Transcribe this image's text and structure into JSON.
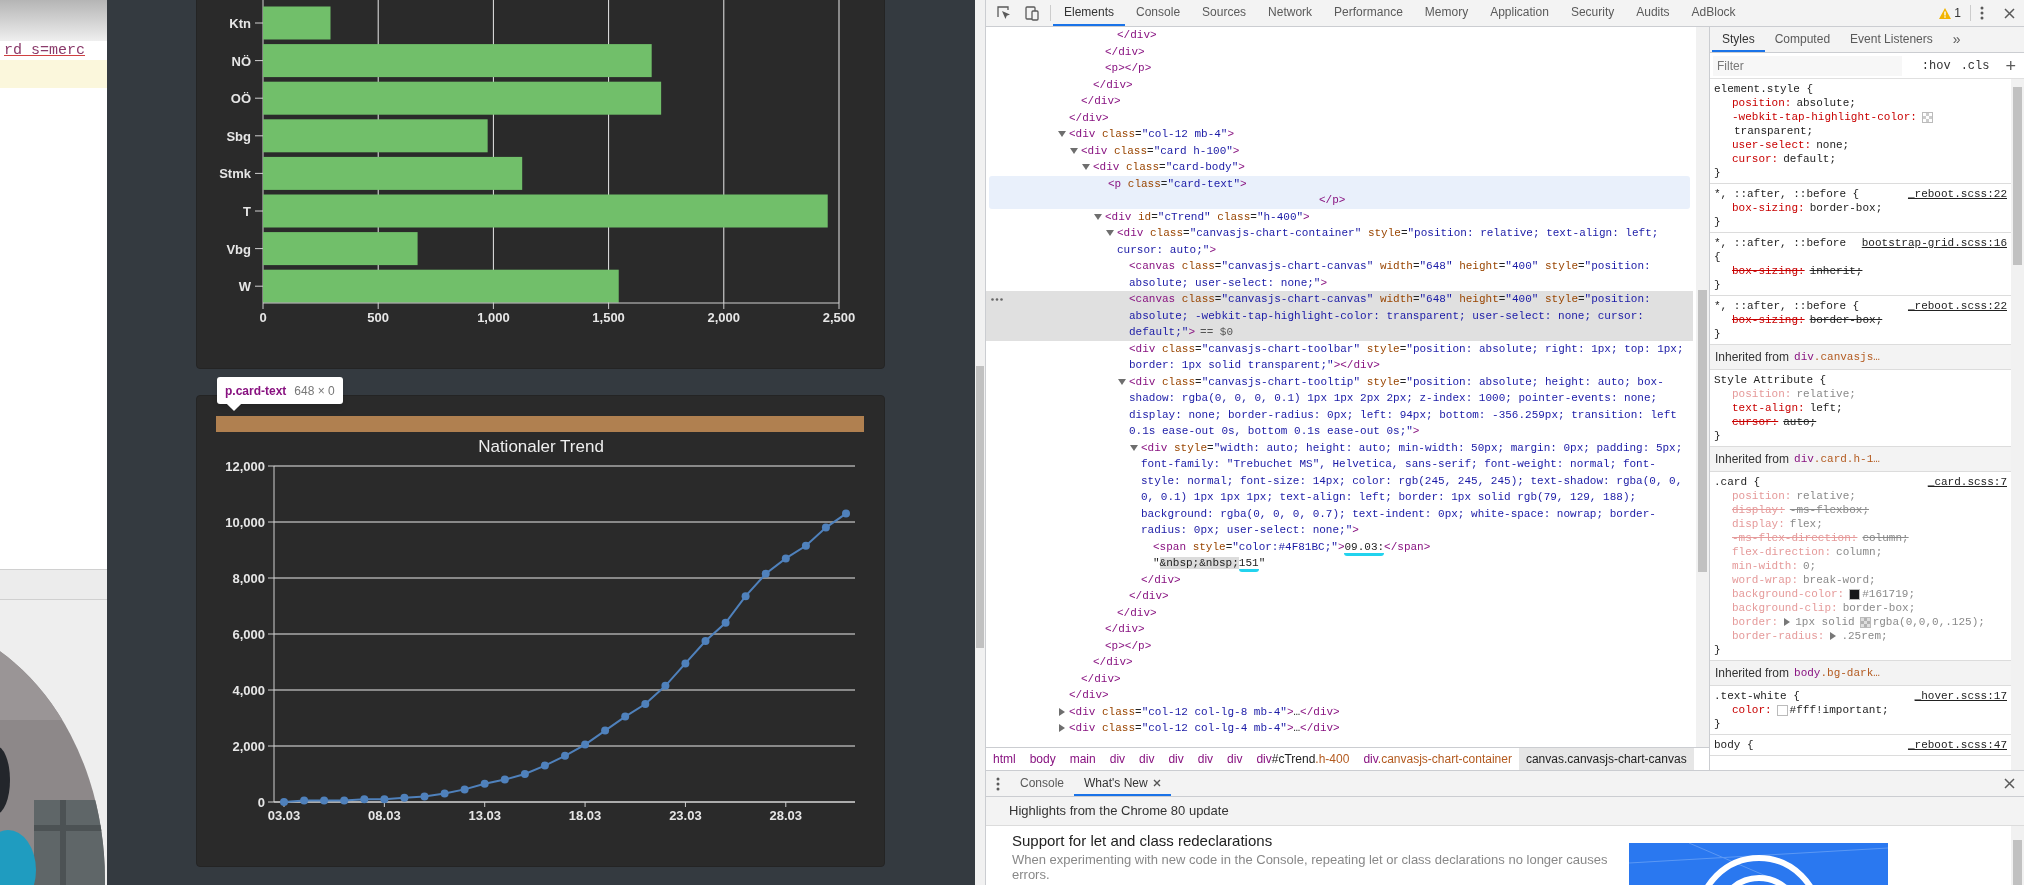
{
  "background_window": {
    "code_text": "rd s=merc"
  },
  "page": {
    "bar_chart_card": {
      "chart_data": {
        "type": "bar",
        "orientation": "horizontal",
        "categories": [
          "Ktn",
          "NÖ",
          "OÖ",
          "Sbg",
          "Stmk",
          "T",
          "Vbg",
          "W"
        ],
        "series": [
          {
            "color": "#71bf6a",
            "values": [
              293,
              1687,
              1728,
              975,
              1125,
              2451,
              671,
              1544
            ]
          }
        ],
        "grid": true,
        "xlim": [
          0,
          2500
        ],
        "xticks": [
          {
            "value": 0,
            "label": "0"
          },
          {
            "value": 500,
            "label": "500"
          },
          {
            "value": 1000,
            "label": "1,000"
          },
          {
            "value": 1500,
            "label": "1,500"
          },
          {
            "value": 2000,
            "label": "2,000"
          },
          {
            "value": 2500,
            "label": "2,500"
          }
        ]
      }
    },
    "inspect_tooltip": {
      "selector": "p.card-text",
      "size": "648 × 0"
    },
    "trend_card": {
      "chart_data": {
        "type": "line",
        "title": "Nationaler Trend",
        "categories": [
          "03.03",
          null,
          null,
          null,
          null,
          "08.03",
          null,
          null,
          null,
          null,
          "13.03",
          null,
          null,
          null,
          null,
          "18.03",
          null,
          null,
          null,
          null,
          "23.03",
          null,
          null,
          null,
          null,
          "28.03",
          null,
          null,
          null
        ],
        "series": [
          {
            "color": "#4f81bc",
            "marker": true,
            "values": [
              0,
              50,
              50,
              50,
              100,
              100,
              150,
              200,
              300,
              450,
              650,
              800,
              1000,
              1300,
              1650,
              2050,
              2550,
              3050,
              3500,
              4150,
              4950,
              5750,
              6400,
              7350,
              8150,
              8700,
              9150,
              9800,
              10300
            ]
          }
        ],
        "grid": true,
        "ylim": [
          0,
          12000
        ],
        "yticks": [
          {
            "value": 0,
            "label": "0"
          },
          {
            "value": 2000,
            "label": "2,000"
          },
          {
            "value": 4000,
            "label": "4,000"
          },
          {
            "value": 6000,
            "label": "6,000"
          },
          {
            "value": 8000,
            "label": "8,000"
          },
          {
            "value": 10000,
            "label": "10,000"
          },
          {
            "value": 12000,
            "label": "12,000"
          }
        ]
      }
    }
  },
  "devtools": {
    "toolbar": {
      "tabs": [
        {
          "label": "Elements",
          "selected": true
        },
        {
          "label": "Console",
          "selected": false
        },
        {
          "label": "Sources",
          "selected": false
        },
        {
          "label": "Network",
          "selected": false
        },
        {
          "label": "Performance",
          "selected": false
        },
        {
          "label": "Memory",
          "selected": false
        },
        {
          "label": "Application",
          "selected": false
        },
        {
          "label": "Security",
          "selected": false
        },
        {
          "label": "Audits",
          "selected": false
        },
        {
          "label": "AdBlock",
          "selected": false
        }
      ],
      "warning_count": "1"
    },
    "elements_tree": [
      {
        "close": "</div>",
        "children": [
          {
            "close": "</div>",
            "children": [
              {
                "close": "</div>",
                "children": [
                  {
                    "close": "</div>",
                    "children": [
                      {
                        "close": "</div>"
                      }
                    ]
                  },
                  {
                    "open": "<p></p>"
                  }
                ]
              }
            ]
          }
        ]
      },
      {
        "open": "<div class=\"col-12 mb-4\">",
        "expanded": true,
        "close": "</div>",
        "children": [
          {
            "open": "<div class=\"card h-100\">",
            "expanded": true,
            "close": "</div>",
            "children": [
              {
                "open": "<div class=\"card-body\">",
                "expanded": true,
                "close": "</div>",
                "children": [
                  {
                    "open": "<p class=\"card-text\">",
                    "close": "</p>",
                    "hovered": true
                  },
                  {
                    "open": "<div id=\"cTrend\" class=\"h-400\">",
                    "expanded": true,
                    "close": "</div>",
                    "children": [
                      {
                        "open": "<div class=\"canvasjs-chart-container\" style=\"position: relative; text-align: left; cursor: auto;\">",
                        "expanded": true,
                        "close": "</div>",
                        "children": [
                          {
                            "open": "<canvas class=\"canvasjs-chart-canvas\" width=\"648\" height=\"400\" style=\"position: absolute; user-select: none;\">"
                          },
                          {
                            "open": "<canvas class=\"canvasjs-chart-canvas\" width=\"648\" height=\"400\" style=\"position: absolute; -webkit-tap-highlight-color: transparent; user-select: none; cursor: default;\">",
                            "selected": true,
                            "console_ref": "== $0"
                          },
                          {
                            "open": "<div class=\"canvasjs-chart-toolbar\" style=\"position: absolute; right: 1px; top: 1px; border: 1px solid transparent;\"></div>"
                          },
                          {
                            "open": "<div class=\"canvasjs-chart-tooltip\" style=\"position: absolute; height: auto; box-shadow: rgba(0, 0, 0, 0.1) 1px 1px 2px 2px; z-index: 1000; pointer-events: none; display: none; border-radius: 0px; left: 94px; bottom: -356.259px; transition: left 0.1s ease-out 0s, bottom 0.1s ease-out 0s;\">",
                            "expanded": true,
                            "close": "</div>",
                            "children": [
                              {
                                "open": "<div style=\"width: auto; height: auto; min-width: 50px; margin: 0px; padding: 5px; font-family: \"Trebuchet MS\", Helvetica, sans-serif; font-weight: normal; font-style: normal; font-size: 14px; color: rgb(245, 245, 245); text-shadow: rgba(0, 0, 0, 0.1) 1px 1px 1px; text-align: left; border: 1px solid rgb(79, 129, 188); background: rgba(0, 0, 0, 0.7); text-indent: 0px; white-space: nowrap; border-radius: 0px; user-select: none;\">",
                                "expanded": true,
                                "close": "</div>",
                                "children": [
                                  {
                                    "parts": [
                                      {
                                        "kind": "tag",
                                        "text": "<span style=\"color:#4F81BC;\">"
                                      },
                                      {
                                        "kind": "text",
                                        "text": "09.03:",
                                        "marked": true
                                      },
                                      {
                                        "kind": "tag",
                                        "text": "</span>"
                                      }
                                    ]
                                  },
                                  {
                                    "parts": [
                                      {
                                        "kind": "text",
                                        "text": "\""
                                      },
                                      {
                                        "kind": "text",
                                        "text": "&nbsp;&nbsp;",
                                        "highlighted": true
                                      },
                                      {
                                        "kind": "text",
                                        "text": "151",
                                        "marked": true
                                      },
                                      {
                                        "kind": "text",
                                        "text": "\""
                                      }
                                    ]
                                  }
                                ]
                              }
                            ]
                          }
                        ]
                      }
                    ]
                  },
                  {
                    "open": "<p></p>"
                  }
                ]
              }
            ]
          }
        ]
      },
      {
        "open": "<div class=\"col-12 col-lg-8 mb-4\">…</div>",
        "expanded": false
      },
      {
        "open": "<div class=\"col-12 col-lg-4 mb-4\">…</div>",
        "expanded": false
      }
    ],
    "breadcrumbs": [
      {
        "label": "html",
        "selected": false
      },
      {
        "label": "body",
        "selected": false
      },
      {
        "label": "main",
        "selected": false
      },
      {
        "label": "div",
        "selected": false
      },
      {
        "label": "div",
        "selected": false
      },
      {
        "label": "div",
        "selected": false
      },
      {
        "label": "div",
        "selected": false
      },
      {
        "label": "div",
        "selected": false
      },
      {
        "label": "div#cTrend.h-400",
        "selected": false
      },
      {
        "label": "div.canvasjs-chart-container",
        "selected": false
      },
      {
        "label": "canvas.canvasjs-chart-canvas",
        "selected": true
      }
    ],
    "styles_pane": {
      "tabs": [
        {
          "label": "Styles",
          "selected": true
        },
        {
          "label": "Computed",
          "selected": false
        },
        {
          "label": "Event Listeners",
          "selected": false
        }
      ],
      "more": "»",
      "filter": {
        "placeholder": "Filter"
      },
      "hov": ":hov",
      "cls": ".cls",
      "add": "+",
      "sections": [
        {
          "kind": "rule",
          "selector": "element.style {",
          "properties": [
            {
              "name": "position:",
              "value": "absolute;"
            },
            {
              "name": "-webkit-tap-highlight-color:",
              "color_value": "transparent;"
            },
            {
              "name": "user-select:",
              "value": "none;"
            },
            {
              "name": "cursor:",
              "value": "default;"
            }
          ],
          "end": "}"
        },
        {
          "kind": "rule",
          "selector": "*, ::after, ::before {",
          "source": "_reboot.scss:22",
          "properties": [
            {
              "name": "box-sizing:",
              "value": "border-box;"
            }
          ],
          "end": "}"
        },
        {
          "kind": "rule",
          "selector": "*, ::after, ::before {",
          "source": "bootstrap-grid.scss:16",
          "properties": [
            {
              "name": "box-sizing:",
              "value": "inherit;",
              "struck": true
            }
          ],
          "end": "}"
        },
        {
          "kind": "rule",
          "selector": "*, ::after, ::before {",
          "source": "_reboot.scss:22",
          "properties": [
            {
              "name": "box-sizing:",
              "value": "border-box;",
              "struck": true
            }
          ],
          "end": "}"
        },
        {
          "kind": "inherited",
          "label": "Inherited from",
          "element": "div.canvasjs…"
        },
        {
          "kind": "rule",
          "selector": "Style Attribute {",
          "properties": [
            {
              "name": "position:",
              "value": "relative;",
              "inactive": true
            },
            {
              "name": "text-align:",
              "value": "left;"
            },
            {
              "name": "cursor:",
              "value": "auto;",
              "struck": true
            }
          ],
          "end": "}"
        },
        {
          "kind": "inherited",
          "label": "Inherited from",
          "element": "div.card.h-1…"
        },
        {
          "kind": "rule",
          "selector": ".card {",
          "source": "_card.scss:7",
          "properties": [
            {
              "name": "position:",
              "value": "relative;",
              "inactive": true
            },
            {
              "name": "display:",
              "value": "-ms-flexbox;",
              "inactive": true,
              "struck": true
            },
            {
              "name": "display:",
              "value": "flex;",
              "inactive": true
            },
            {
              "name": "-ms-flex-direction:",
              "value": "column;",
              "inactive": true,
              "struck": true
            },
            {
              "name": "flex-direction:",
              "value": "column;",
              "inactive": true
            },
            {
              "name": "min-width:",
              "value": "0;",
              "inactive": true
            },
            {
              "name": "word-wrap:",
              "value": "break-word;",
              "inactive": true
            },
            {
              "name": "background-color:",
              "color_value": "#161719;",
              "inactive": true
            },
            {
              "name": "background-clip:",
              "value": "border-box;",
              "inactive": true
            },
            {
              "name": "border:",
              "value": "1px solid",
              "color_value": "rgba(0,0,0,.125);",
              "inactive": true,
              "expandable": true
            },
            {
              "name": "border-radius:",
              "value": ".25rem;",
              "inactive": true,
              "expandable": true
            }
          ],
          "end": "}"
        },
        {
          "kind": "inherited",
          "label": "Inherited from",
          "element": "body.bg-dark…"
        },
        {
          "kind": "rule",
          "selector": ".text-white {",
          "source": "_hover.scss:17",
          "properties": [
            {
              "name": "color:",
              "color_value": "#fff!important;"
            }
          ],
          "end": "}"
        },
        {
          "kind": "rule",
          "selector": "body {",
          "source": "_reboot.scss:47"
        }
      ]
    },
    "drawer": {
      "tabs": [
        {
          "label": "Console",
          "selected": false
        },
        {
          "label": "What's New",
          "selected": true,
          "closable": true
        }
      ],
      "banner": "Highlights from the Chrome 80 update",
      "article": {
        "title": "Support for let and class redeclarations",
        "description": "When experimenting with new code in the Console, repeating let or class declarations no longer causes errors."
      }
    }
  }
}
